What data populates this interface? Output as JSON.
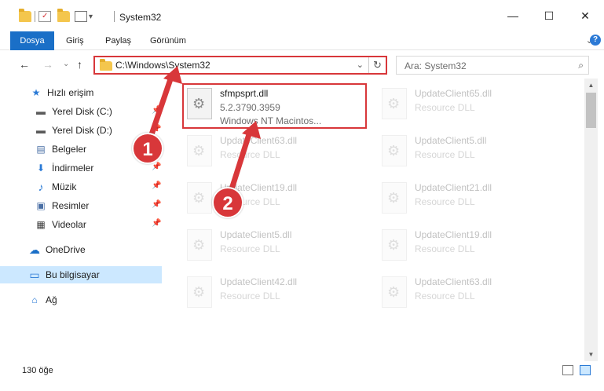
{
  "window": {
    "title": "System32",
    "minimize_glyph": "—",
    "maximize_glyph": "☐",
    "close_glyph": "✕",
    "qa_dropdown_glyph": "▾"
  },
  "ribbon": {
    "tabs": [
      {
        "label": "Dosya",
        "active": true
      },
      {
        "label": "Giriş"
      },
      {
        "label": "Paylaş"
      },
      {
        "label": "Görünüm"
      }
    ],
    "expand_glyph": "⌄",
    "help_glyph": "?"
  },
  "nav": {
    "back_glyph": "←",
    "forward_glyph": "→",
    "recent_glyph": "⌄",
    "up_glyph": "↑",
    "address": "C:\\Windows\\System32",
    "address_drop_glyph": "⌄",
    "refresh_glyph": "↻",
    "search_placeholder": "Ara: System32",
    "search_glyph": "⌕"
  },
  "sidebar": {
    "items": [
      {
        "label": "Hızlı erişim",
        "icon": "star-icon",
        "glyph": "★",
        "color": "#2a7ad6"
      },
      {
        "label": "Yerel Disk (C:)",
        "icon": "drive-icon",
        "glyph": "▬",
        "color": "#5a5a5a",
        "pinned": true
      },
      {
        "label": "Yerel Disk (D:)",
        "icon": "drive-icon",
        "glyph": "▬",
        "color": "#5a5a5a",
        "pinned": true
      },
      {
        "label": "Belgeler",
        "icon": "document-icon",
        "glyph": "▤",
        "color": "#4a6fa5",
        "pinned": true
      },
      {
        "label": "İndirmeler",
        "icon": "download-icon",
        "glyph": "⬇",
        "color": "#2a7ad6",
        "pinned": true
      },
      {
        "label": "Müzik",
        "icon": "music-icon",
        "glyph": "♪",
        "color": "#2a7ad6",
        "pinned": true
      },
      {
        "label": "Resimler",
        "icon": "picture-icon",
        "glyph": "▣",
        "color": "#4a6fa5",
        "pinned": true
      },
      {
        "label": "Videolar",
        "icon": "video-icon",
        "glyph": "▦",
        "color": "#3a3a3a",
        "pinned": true
      },
      {
        "label": "OneDrive",
        "icon": "cloud-icon",
        "glyph": "☁",
        "color": "#1a6fc7"
      },
      {
        "label": "Bu bilgisayar",
        "icon": "computer-icon",
        "glyph": "▭",
        "color": "#2a7ad6",
        "selected": true
      },
      {
        "label": "Ağ",
        "icon": "network-icon",
        "glyph": "⌂",
        "color": "#2a7ad6"
      }
    ],
    "pin_glyph": "📌"
  },
  "files": [
    {
      "name": "sfmpsprt.dll",
      "line2": "5.2.3790.3959",
      "line3": "Windows NT Macintos...",
      "highlighted": true
    },
    {
      "name": "UpdateClient65.dll",
      "line2": "Resource DLL"
    },
    {
      "name": "UpdateClient63.dll",
      "line2": "Resource DLL"
    },
    {
      "name": "UpdateClient5.dll",
      "line2": "Resource DLL"
    },
    {
      "name": "UpdateClient19.dll",
      "line2": "Resource DLL"
    },
    {
      "name": "UpdateClient21.dll",
      "line2": "Resource DLL"
    },
    {
      "name": "UpdateClient5.dll",
      "line2": "Resource DLL"
    },
    {
      "name": "UpdateClient19.dll",
      "line2": "Resource DLL"
    },
    {
      "name": "UpdateClient42.dll",
      "line2": "Resource DLL"
    },
    {
      "name": "UpdateClient63.dll",
      "line2": "Resource DLL"
    }
  ],
  "status": {
    "item_count": "130 öğe"
  },
  "annotations": {
    "step1": "1",
    "step2": "2",
    "accent_color": "#d8373a"
  }
}
